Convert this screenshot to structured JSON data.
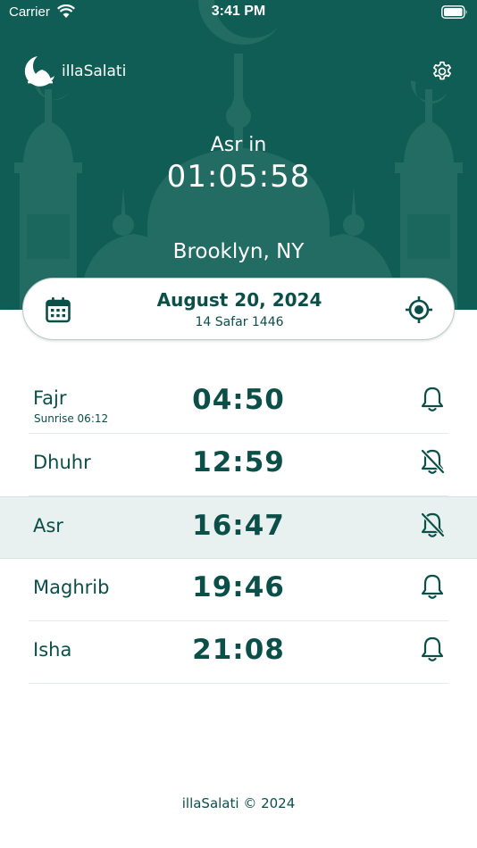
{
  "status_bar": {
    "carrier": "Carrier",
    "time": "3:41 PM"
  },
  "header": {
    "app_name": "illaSalati",
    "next_prayer_label": "Asr in",
    "countdown": "01:05:58",
    "location": "Brooklyn, NY"
  },
  "date_card": {
    "gregorian": "August 20, 2024",
    "hijri": "14 Safar 1446"
  },
  "prayers": [
    {
      "name": "Fajr",
      "sub": "Sunrise 06:12",
      "time": "04:50",
      "alert": "on"
    },
    {
      "name": "Dhuhr",
      "time": "12:59",
      "alert": "off"
    },
    {
      "name": "Asr",
      "time": "16:47",
      "alert": "off",
      "active": true
    },
    {
      "name": "Maghrib",
      "time": "19:46",
      "alert": "on"
    },
    {
      "name": "Isha",
      "time": "21:08",
      "alert": "on"
    }
  ],
  "footer": "illaSalati © 2024",
  "colors": {
    "primary": "#0f5d54",
    "text": "#0b4f49",
    "active_row": "#e8f1ef",
    "silhouette": "#2a7168"
  },
  "icons": [
    "wifi-icon",
    "battery-icon",
    "mosque-logo-icon",
    "gear-icon",
    "calendar-icon",
    "location-target-icon",
    "bell-icon",
    "bell-slash-icon"
  ]
}
